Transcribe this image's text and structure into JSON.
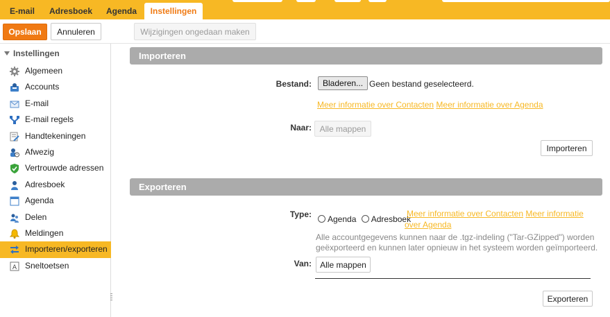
{
  "tabs": [
    {
      "label": "E-mail",
      "active": false
    },
    {
      "label": "Adresboek",
      "active": false
    },
    {
      "label": "Agenda",
      "active": false
    },
    {
      "label": "Instellingen",
      "active": true
    }
  ],
  "toolbar": {
    "save_label": "Opslaan",
    "cancel_label": "Annuleren",
    "undo_label": "Wijzigingen ongedaan maken"
  },
  "sidebar": {
    "heading": "Instellingen",
    "items": [
      {
        "label": "Algemeen",
        "icon": "gear-icon"
      },
      {
        "label": "Accounts",
        "icon": "accounts-icon"
      },
      {
        "label": "E-mail",
        "icon": "envelope-icon"
      },
      {
        "label": "E-mail regels",
        "icon": "filter-rules-icon"
      },
      {
        "label": "Handtekeningen",
        "icon": "signature-icon"
      },
      {
        "label": "Afwezig",
        "icon": "out-of-office-icon"
      },
      {
        "label": "Vertrouwde adressen",
        "icon": "shield-check-icon"
      },
      {
        "label": "Adresboek",
        "icon": "contact-icon"
      },
      {
        "label": "Agenda",
        "icon": "calendar-icon"
      },
      {
        "label": "Delen",
        "icon": "share-icon"
      },
      {
        "label": "Meldingen",
        "icon": "bell-icon"
      },
      {
        "label": "Importeren/exporteren",
        "icon": "import-export-icon",
        "selected": true
      },
      {
        "label": "Sneltoetsen",
        "icon": "keyboard-icon"
      }
    ]
  },
  "import": {
    "title": "Importeren",
    "file_label": "Bestand:",
    "browse_label": "Bladeren...",
    "no_file_text": "Geen bestand geselecteerd.",
    "link_contacts": "Meer informatie over Contacten",
    "link_calendar": "Meer informatie over Agenda",
    "to_label": "Naar:",
    "to_value": "Alle mappen",
    "button_label": "Importeren"
  },
  "export": {
    "title": "Exporteren",
    "type_label": "Type:",
    "option_calendar": "Agenda",
    "option_addressbook": "Adresboek",
    "link_contacts": "Meer informatie over Contacten",
    "link_more_line1": "Meer informatie",
    "link_more_line2": "over Agenda",
    "help_line1": "Alle accountgegevens kunnen naar de .tgz-indeling (\"Tar-GZipped\") worden",
    "help_line2": "geëxporteerd en kunnen later opnieuw in het systeem worden geïmporteerd.",
    "from_label": "Van:",
    "from_value": "Alle mappen",
    "button_label": "Exporteren"
  },
  "colors": {
    "brand_yellow": "#f7b824",
    "accent_orange": "#f07a13",
    "section_gray": "#ababab"
  }
}
